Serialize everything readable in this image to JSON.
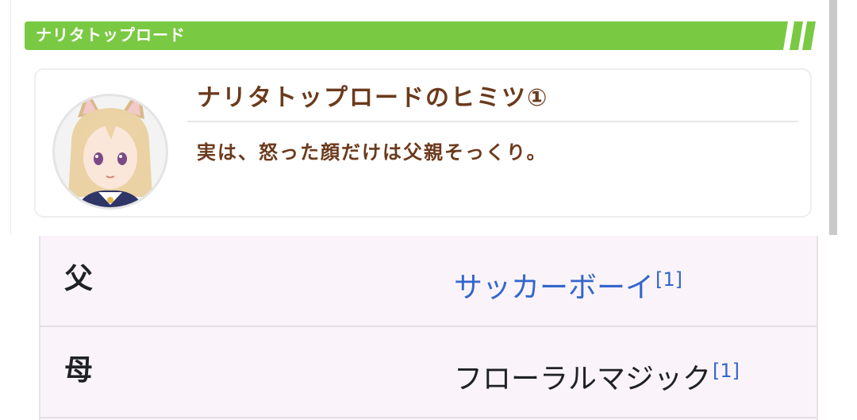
{
  "banner": {
    "title": "ナリタトップロード",
    "color": "#7ac943"
  },
  "card": {
    "avatar_icon": "character-portrait-icon",
    "title": "ナリタトップロードのヒミツ①",
    "text": "実は、怒った顔だけは父親そっくり。",
    "text_color": "#6b3a1c"
  },
  "table": {
    "rows": [
      {
        "label": "父",
        "value": "サッカーボーイ",
        "ref": "[1]",
        "is_link": true
      },
      {
        "label": "母",
        "value": "フローラルマジック",
        "ref": "[1]",
        "is_link": false
      }
    ]
  },
  "colors": {
    "link": "#3366cc",
    "table_bg": "#faf4fa"
  }
}
